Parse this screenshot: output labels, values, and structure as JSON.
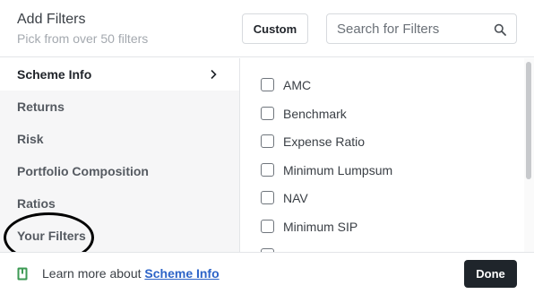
{
  "header": {
    "title": "Add Filters",
    "subtitle": "Pick from over 50 filters",
    "custom_label": "Custom",
    "search_placeholder": "Search for Filters"
  },
  "sidebar": {
    "items": [
      {
        "label": "Scheme Info",
        "active": true
      },
      {
        "label": "Returns"
      },
      {
        "label": "Risk"
      },
      {
        "label": "Portfolio Composition"
      },
      {
        "label": "Ratios"
      },
      {
        "label": "Your Filters"
      }
    ]
  },
  "options": [
    {
      "label": "AMC",
      "checked": false
    },
    {
      "label": "Benchmark",
      "checked": false
    },
    {
      "label": "Expense Ratio",
      "checked": false
    },
    {
      "label": "Minimum Lumpsum",
      "checked": false
    },
    {
      "label": "NAV",
      "checked": false
    },
    {
      "label": "Minimum SIP",
      "checked": false
    },
    {
      "label": "",
      "checked": false
    }
  ],
  "footer": {
    "learn_prefix": "Learn more about ",
    "learn_link": "Scheme Info",
    "done_label": "Done"
  },
  "colors": {
    "link": "#2d64c8",
    "done_bg": "#1f252b",
    "book_icon": "#3d9a54"
  },
  "icons": [
    "search-icon",
    "chevron-right-icon",
    "book-icon"
  ]
}
